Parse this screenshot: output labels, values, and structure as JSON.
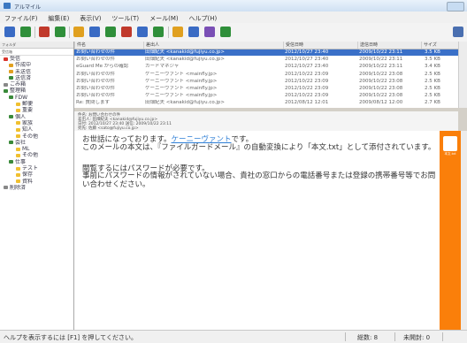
{
  "window": {
    "title": "アルマイル"
  },
  "menu": [
    "ファイル(F)",
    "編集(E)",
    "表示(V)",
    "ツール(T)",
    "メール(M)",
    "ヘルプ(H)"
  ],
  "toolbar": {
    "button_colors": [
      "#3a6bc4",
      "#2f8f3a",
      "#c0392b",
      "#2f8f3a",
      "#e0a020",
      "#3a6bc4",
      "#2f8f3a",
      "#c0392b",
      "#3a6bc4",
      "#2f8f3a",
      "#e0a020",
      "#3a6bc4",
      "#7a4fb5",
      "#2f8f3a"
    ]
  },
  "sidebar": {
    "header": "フォルダ",
    "subheader": "受信箱",
    "tree": [
      {
        "label": "受信",
        "indent": 4,
        "icon": "#d9342b"
      },
      {
        "label": "作成中",
        "indent": 10,
        "icon": "#e0a020"
      },
      {
        "label": "未送信",
        "indent": 10,
        "icon": "#e0a020"
      },
      {
        "label": "送信済",
        "indent": 10,
        "icon": "#3a8a3a"
      },
      {
        "label": "ごみ箱",
        "indent": 4,
        "icon": "#888888"
      },
      {
        "label": "整理箱",
        "indent": 4,
        "icon": "#3a8a3a"
      },
      {
        "label": "FDW",
        "indent": 10,
        "icon": "#3a8a3a"
      },
      {
        "label": "郵便",
        "indent": 18,
        "icon": "#f0c030"
      },
      {
        "label": "重要",
        "indent": 18,
        "icon": "#f0c030"
      },
      {
        "label": "個人",
        "indent": 10,
        "icon": "#3a8a3a"
      },
      {
        "label": "家族",
        "indent": 18,
        "icon": "#f0c030"
      },
      {
        "label": "知人",
        "indent": 18,
        "icon": "#f0c030"
      },
      {
        "label": "その他",
        "indent": 18,
        "icon": "#f0c030"
      },
      {
        "label": "会社",
        "indent": 10,
        "icon": "#3a8a3a"
      },
      {
        "label": "ML",
        "indent": 18,
        "icon": "#f0c030"
      },
      {
        "label": "その他",
        "indent": 18,
        "icon": "#f0c030"
      },
      {
        "label": "仕事",
        "indent": 10,
        "icon": "#3a8a3a"
      },
      {
        "label": "テスト",
        "indent": 18,
        "icon": "#f0c030"
      },
      {
        "label": "保存",
        "indent": 18,
        "icon": "#f0c030"
      },
      {
        "label": "資料",
        "indent": 18,
        "icon": "#f0c030"
      },
      {
        "label": "削除済",
        "indent": 4,
        "icon": "#888888"
      }
    ]
  },
  "list": {
    "columns": [
      "件名",
      "差出人",
      "受信日時",
      "送信日時",
      "サイズ"
    ],
    "rows": [
      {
        "subject": "お問い合わせの件",
        "from": "田畑紀夫 <kanakid@fujiyu.co.jp>",
        "received": "2012/10/27 23:40",
        "sent": "2009/10/22 23:11",
        "size": "3.5 KB",
        "selected": true
      },
      {
        "subject": "お問い合わせの件",
        "from": "田畑紀夫 <kanakid@fujiyu.co.jp>",
        "received": "2012/10/27 23:40",
        "sent": "2009/10/22 23:11",
        "size": "3.5 KB",
        "selected": false
      },
      {
        "subject": "eGuard Me からの確認",
        "from": "カードマネジャ",
        "received": "2012/10/27 23:40",
        "sent": "2009/10/22 23:11",
        "size": "3.4 KB",
        "selected": false
      },
      {
        "subject": "お問い合わせの件",
        "from": "ケーニーヴァント <mainfly.jp>",
        "received": "2012/10/22 23:09",
        "sent": "2009/10/22 23:08",
        "size": "2.5 KB",
        "selected": false
      },
      {
        "subject": "お問い合わせの件",
        "from": "ケーニーヴァント <mainfly.jp>",
        "received": "2012/10/22 23:09",
        "sent": "2009/10/22 23:08",
        "size": "2.5 KB",
        "selected": false
      },
      {
        "subject": "お問い合わせの件",
        "from": "ケーニーヴァント <mainfly.jp>",
        "received": "2012/10/22 23:09",
        "sent": "2009/10/22 23:08",
        "size": "2.5 KB",
        "selected": false
      },
      {
        "subject": "お問い合わせの件",
        "from": "ケーニーヴァント <mainfly.jp>",
        "received": "2012/10/22 23:09",
        "sent": "2009/10/22 23:08",
        "size": "2.5 KB",
        "selected": false
      },
      {
        "subject": "Re: 質問します",
        "from": "田畑紀夫 <kanakid@fujiyu.co.jp>",
        "received": "2012/08/12 12:01",
        "sent": "2009/08/12 12:00",
        "size": "2.7 KB",
        "selected": false
      }
    ]
  },
  "message_header": [
    "件名: お問い合わせの件",
    "差出人: 田畑紀夫 <kanakid@fujiyu.co.jp>",
    "日付: 2012/10/27 23:40   送信: 2009/10/22 23:11",
    "宛先: 佐藤 <sato@fujiyu.co.jp>"
  ],
  "message_body": {
    "line1_pre": "お世話になっております。",
    "line1_link": "ケーニーヴァント",
    "line1_post": "です。",
    "line2": "このメールの本文は、『ファイルガードメール』の自動変換により「本文.txt」として添付されています。",
    "line3": "閲覧するにはパスワードが必要です。",
    "line4": "事前にパスワードの情報がされていない場合、貴社の窓口からの電話番号または登録の携帯番号等でお問い合わせください。"
  },
  "attachment": {
    "label": "本文.txt"
  },
  "status": {
    "help": "ヘルプを表示するには [F1] を押してください。",
    "total": "総数: 8",
    "unread": "未開封: 0"
  }
}
